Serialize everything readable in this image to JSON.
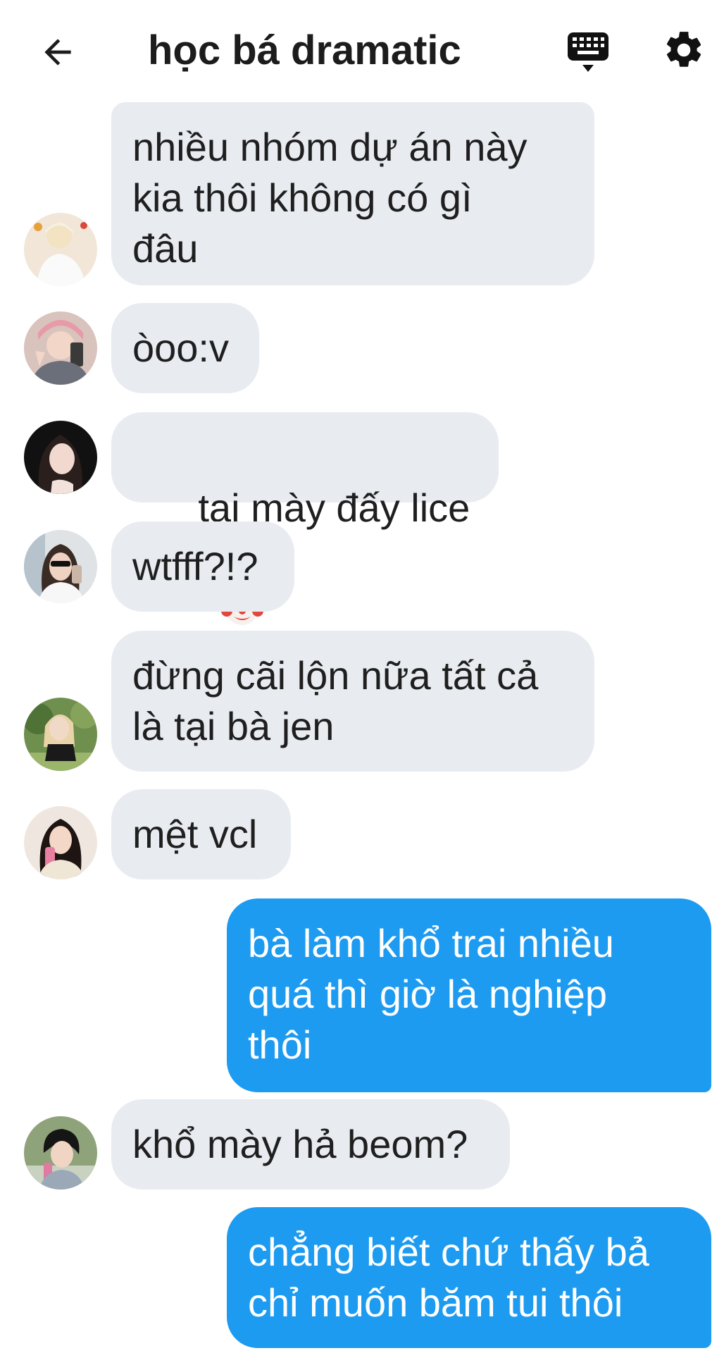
{
  "header": {
    "title": "học bá dramatic",
    "back_icon": "arrow-left-icon",
    "keyboard_icon": "keyboard-icon",
    "settings_icon": "gear-icon"
  },
  "colors": {
    "incoming_bubble": "#e8ebf0",
    "outgoing_bubble": "#1d9bf0",
    "text": "#1f1f1f"
  },
  "messages": [
    {
      "direction": "in",
      "text": "nhiều nhóm dự án này\nkia thôi không có gì\nđâu",
      "avatar": "avatar-blond-boy"
    },
    {
      "direction": "in",
      "text": "òoo:v",
      "avatar": "avatar-pink-hair"
    },
    {
      "direction": "in",
      "text": "tại mày đấy lice",
      "emoji": "clown-face-icon",
      "avatar": "avatar-dark-hair-girl"
    },
    {
      "direction": "in",
      "text": "wtfff?!?",
      "avatar": "avatar-sunglasses-girl"
    },
    {
      "direction": "in",
      "text": "đừng cãi lộn nữa tất cả\nlà tại bà jen",
      "avatar": "avatar-garden-girl"
    },
    {
      "direction": "in",
      "text": "mệt vcl",
      "avatar": "avatar-drink-girl"
    },
    {
      "direction": "out",
      "text": "bà làm khổ trai nhiều\nquá thì giờ là nghiệp\nthôi"
    },
    {
      "direction": "in",
      "text": "khổ mày hả beom?",
      "avatar": "avatar-short-hair"
    },
    {
      "direction": "out",
      "text": "chẳng biết chứ thấy bả\nchỉ muốn băm tui thôi"
    }
  ]
}
